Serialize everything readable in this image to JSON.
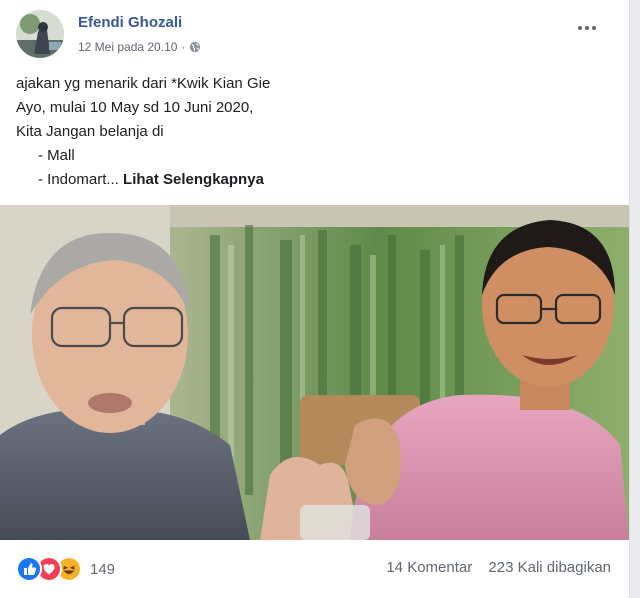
{
  "post": {
    "author": "Efendi Ghozali",
    "timestamp": "12 Mei pada 20.10",
    "separator": "·",
    "privacy_icon": "globe-icon",
    "more_icon": "more-options-icon",
    "text": {
      "line1": "ajakan yg menarik dari *Kwik Kian Gie",
      "line2": "Ayo, mulai 10 May  sd  10 Juni 2020,",
      "line3": "Kita Jangan belanja di",
      "line4": "- Mall",
      "line5": "- Indomart...",
      "see_more": "Lihat Selengkapnya"
    }
  },
  "footer": {
    "reaction_icons": [
      "like-icon",
      "love-icon",
      "haha-icon"
    ],
    "reaction_count": "149",
    "comments": "14 Komentar",
    "shares": "223 Kali dibagikan"
  },
  "colors": {
    "link_blue": "#385898",
    "like_blue": "#1877f2",
    "love_red": "#f33e58",
    "haha_yellow": "#f7b125"
  }
}
